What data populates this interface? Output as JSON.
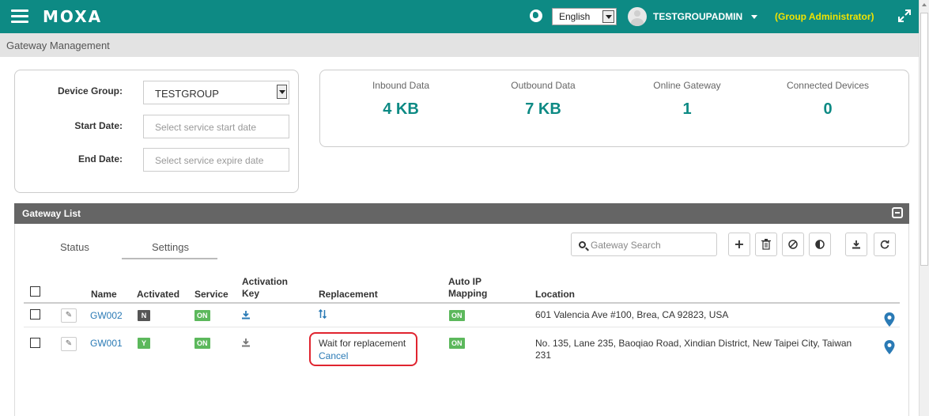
{
  "header": {
    "brand": "MOXA",
    "language": "English",
    "username": "TESTGROUPADMIN",
    "role": "(Group Administrator)"
  },
  "breadcrumb": "Gateway Management",
  "filters": {
    "device_group_label": "Device Group:",
    "device_group_value": "TESTGROUP",
    "start_date_label": "Start Date:",
    "start_date_placeholder": "Select service start date",
    "end_date_label": "End Date:",
    "end_date_placeholder": "Select service expire date"
  },
  "stats": [
    {
      "label": "Inbound Data",
      "value": "4 KB"
    },
    {
      "label": "Outbound Data",
      "value": "7 KB"
    },
    {
      "label": "Online Gateway",
      "value": "1"
    },
    {
      "label": "Connected Devices",
      "value": "0"
    }
  ],
  "panel": {
    "title": "Gateway List",
    "tabs": [
      "Status",
      "Settings"
    ],
    "active_tab": "Settings",
    "search_placeholder": "Gateway Search",
    "toolbar_icons": [
      "add-icon",
      "delete-icon",
      "disable-icon",
      "toggle-icon",
      "download-icon",
      "refresh-icon"
    ]
  },
  "table": {
    "columns": {
      "name": "Name",
      "activated": "Activated",
      "service": "Service",
      "activation_key_1": "Activation",
      "activation_key_2": "Key",
      "replacement": "Replacement",
      "auto_ip_1": "Auto IP",
      "auto_ip_2": "Mapping",
      "location": "Location"
    },
    "rows": [
      {
        "name": "GW002",
        "activated": "N",
        "service": "ON",
        "auto_ip": "ON",
        "location_1": "601 Valencia Ave #100, Brea, CA 92823, USA",
        "location_2": ""
      },
      {
        "name": "GW001",
        "activated": "Y",
        "service": "ON",
        "replacement_status": "Wait for replacement",
        "replacement_action": "Cancel",
        "auto_ip": "ON",
        "location_1": "No. 135, Lane 235, Baoqiao Road, Xindian District, New Taipei City, Taiwan",
        "location_2": "231"
      }
    ]
  },
  "colors": {
    "brand_teal": "#0d8a84",
    "role_yellow": "#f2e300",
    "link_blue": "#2a7ab5",
    "badge_green": "#5cb85c",
    "highlight_red": "#e0242f"
  }
}
